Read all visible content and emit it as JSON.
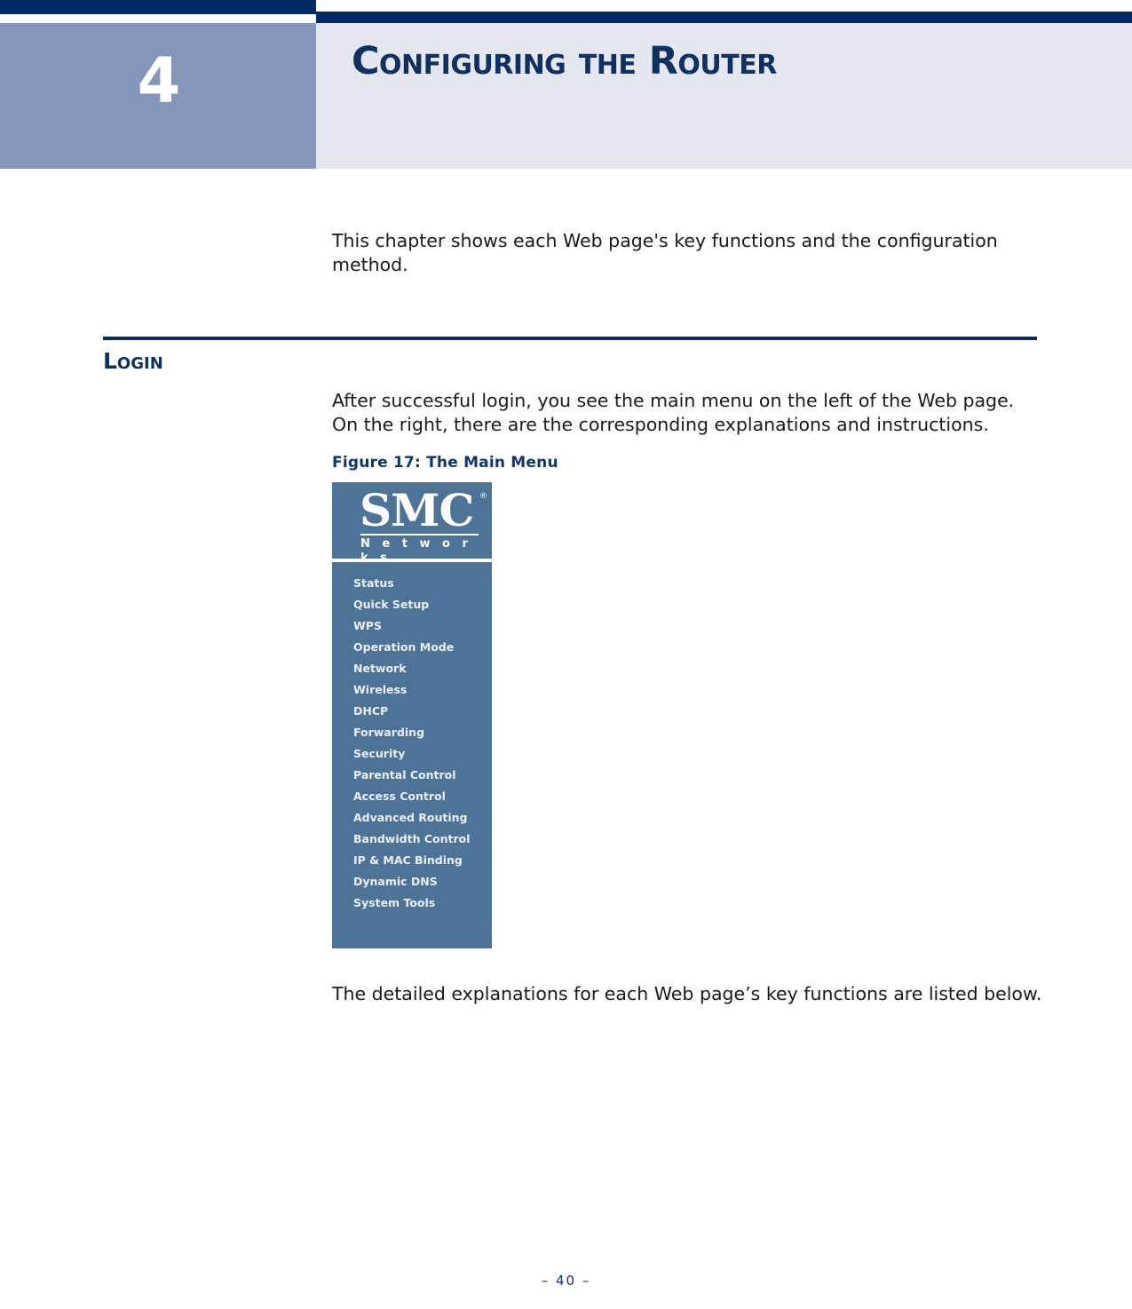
{
  "page": {
    "chapter_number": "4",
    "chapter_title": "Configuring the Router",
    "footer": "–  40  –",
    "colors": {
      "navy_rule": "#012a66",
      "chapter_block": "#8496ba",
      "title_block_bg": "#e4e7f0",
      "heading_navy": "#103060",
      "figure_panel_blue": "#4d7396"
    }
  },
  "content": {
    "intro_paragraph": "This chapter shows each Web page's key functions and the configuration method.",
    "section_heading": "Login",
    "login_paragraph": "After successful login, you see the main menu on the left of the Web page. On the right, there are the corresponding explanations and instructions.",
    "figure_caption": "Figure 17:  The Main Menu",
    "closing_paragraph": "The detailed explanations for each Web page’s key functions are listed below."
  },
  "figure": {
    "logo": {
      "wordmark": "SMC",
      "registered_mark": "®",
      "subtitle": "N e t w o r k s"
    },
    "menu_items": [
      {
        "label": "Status"
      },
      {
        "label": "Quick Setup"
      },
      {
        "label": "WPS"
      },
      {
        "label": "Operation Mode"
      },
      {
        "label": "Network"
      },
      {
        "label": "Wireless"
      },
      {
        "label": "DHCP"
      },
      {
        "label": "Forwarding"
      },
      {
        "label": "Security"
      },
      {
        "label": "Parental Control"
      },
      {
        "label": "Access Control"
      },
      {
        "label": "Advanced Routing"
      },
      {
        "label": "Bandwidth Control"
      },
      {
        "label": "IP & MAC Binding"
      },
      {
        "label": "Dynamic DNS"
      },
      {
        "label": "System Tools"
      }
    ]
  }
}
